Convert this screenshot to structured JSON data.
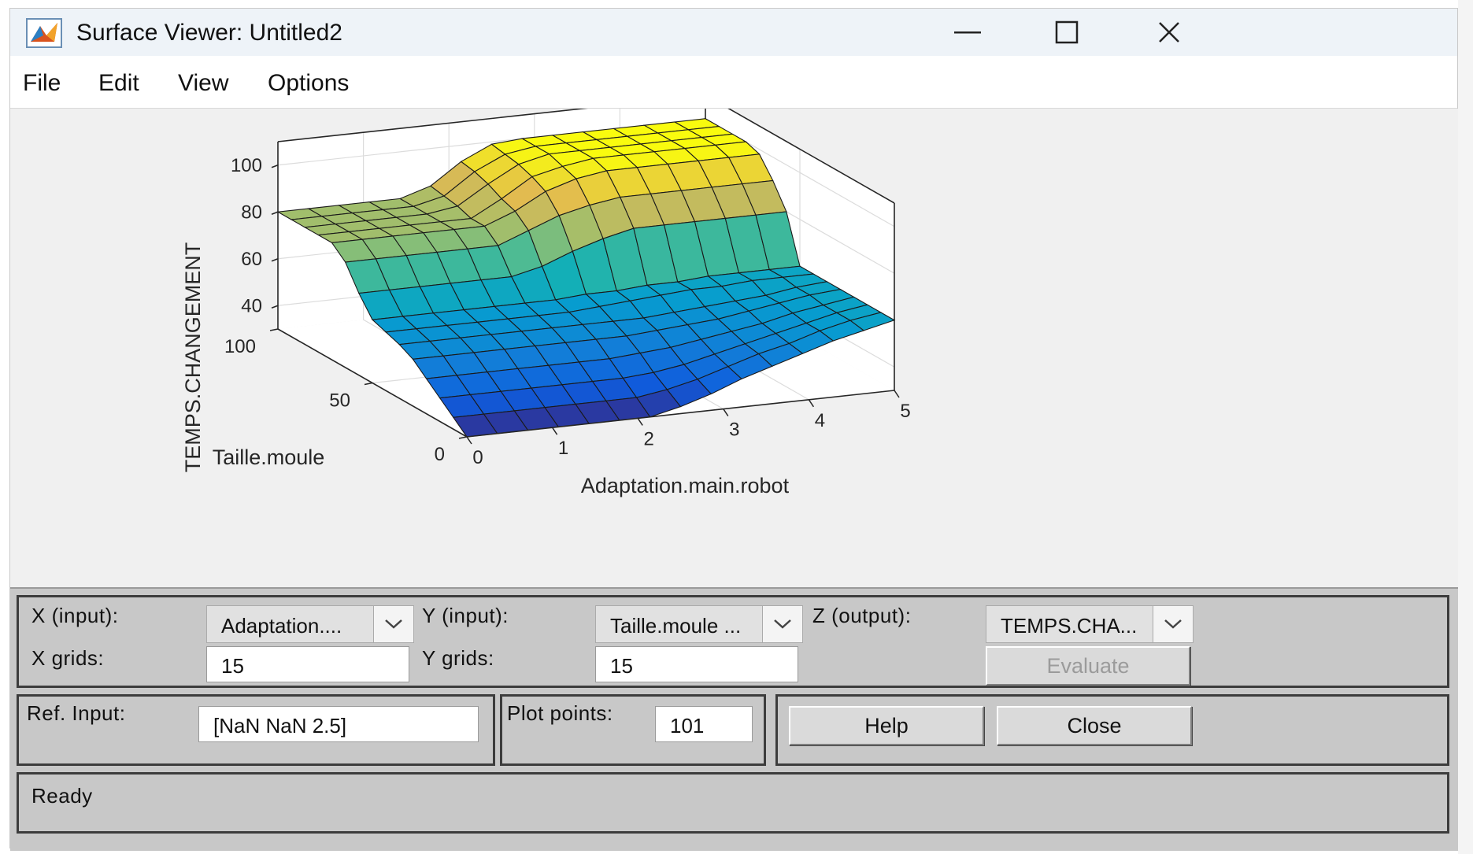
{
  "window": {
    "title": "Surface Viewer: Untitled2",
    "controls": [
      "minimize-icon",
      "maximize-icon",
      "close-icon"
    ]
  },
  "menu": {
    "items": [
      "File",
      "Edit",
      "View",
      "Options"
    ]
  },
  "plot": {
    "zlabel": "TEMPS.CHANGEMENT",
    "ylabel": "Taille.moule",
    "xlabel": "Adaptation.main.robot",
    "z_ticks": [
      "100",
      "80",
      "60",
      "40"
    ],
    "y_ticks": [
      "100",
      "50",
      "0"
    ],
    "x_ticks": [
      "0",
      "1",
      "2",
      "3",
      "4",
      "5"
    ],
    "colormap": "parula"
  },
  "chart_data": {
    "type": "surface",
    "xlabel": "Adaptation.main.robot",
    "ylabel": "Taille.moule",
    "zlabel": "TEMPS.CHANGEMENT",
    "xlim": [
      0,
      5
    ],
    "ylim": [
      0,
      100
    ],
    "zlim": [
      30,
      110
    ],
    "grid": true,
    "x": [
      0,
      0.357,
      0.714,
      1.071,
      1.429,
      1.786,
      2.143,
      2.5,
      2.857,
      3.214,
      3.571,
      3.929,
      4.286,
      4.643,
      5.0
    ],
    "y": [
      0,
      7.14,
      14.29,
      21.43,
      28.57,
      35.71,
      42.86,
      50,
      57.14,
      64.29,
      71.43,
      78.57,
      85.71,
      92.86,
      100
    ],
    "z_rows_by_y": [
      [
        30,
        30,
        30,
        30,
        30,
        30,
        30,
        33,
        37,
        42,
        46,
        50,
        54,
        57,
        60
      ],
      [
        35,
        35,
        35,
        35,
        35,
        35,
        35,
        37,
        40,
        44,
        48,
        51,
        55,
        58,
        60
      ],
      [
        40,
        40,
        40,
        40,
        40,
        40,
        40,
        41,
        43,
        46,
        49,
        52,
        55,
        58,
        60
      ],
      [
        45,
        45,
        45,
        45,
        45,
        45,
        45,
        46,
        47,
        49,
        51,
        53,
        56,
        58,
        60
      ],
      [
        50,
        50,
        50,
        50,
        50,
        50,
        50,
        50,
        51,
        52,
        53,
        55,
        57,
        59,
        60
      ],
      [
        53,
        53,
        53,
        53,
        53,
        53,
        53,
        53,
        53,
        54,
        55,
        56,
        57,
        59,
        60
      ],
      [
        55,
        55,
        55,
        55,
        55,
        55,
        55,
        56,
        57,
        58,
        59,
        59,
        60,
        60,
        60
      ],
      [
        57,
        57,
        57,
        57,
        57,
        57,
        57,
        58,
        58,
        59,
        59,
        60,
        60,
        60,
        60
      ],
      [
        65,
        65,
        65,
        65,
        65,
        65,
        68,
        73,
        77,
        80,
        80,
        80,
        80,
        80,
        80
      ],
      [
        75,
        75,
        75,
        75,
        75,
        75,
        80,
        85,
        88,
        90,
        90,
        90,
        90,
        90,
        90
      ],
      [
        80,
        80,
        80,
        80,
        80,
        80,
        85,
        92,
        96,
        98,
        98,
        98,
        98,
        98,
        98
      ],
      [
        80,
        80,
        80,
        80,
        80,
        80,
        87,
        95,
        98,
        100,
        100,
        100,
        100,
        100,
        100
      ],
      [
        80,
        80,
        80,
        80,
        80,
        82,
        90,
        97,
        100,
        100,
        100,
        100,
        100,
        100,
        100
      ],
      [
        80,
        80,
        80,
        80,
        80,
        83,
        92,
        98,
        100,
        100,
        100,
        100,
        100,
        100,
        100
      ],
      [
        80,
        80,
        80,
        80,
        80,
        84,
        93,
        99,
        100,
        100,
        100,
        100,
        100,
        100,
        100
      ]
    ]
  },
  "controls": {
    "x_input_label": "X (input):",
    "x_input_value": "Adaptation....",
    "y_input_label": "Y (input):",
    "y_input_value": "Taille.moule ...",
    "z_output_label": "Z (output):",
    "z_output_value": "TEMPS.CHA...",
    "x_grids_label": "X grids:",
    "x_grids_value": "15",
    "y_grids_label": "Y grids:",
    "y_grids_value": "15",
    "evaluate_label": "Evaluate",
    "ref_input_label": "Ref. Input:",
    "ref_input_value": "[NaN NaN 2.5]",
    "plot_points_label": "Plot points:",
    "plot_points_value": "101",
    "help_label": "Help",
    "close_label": "Close",
    "status": "Ready"
  }
}
